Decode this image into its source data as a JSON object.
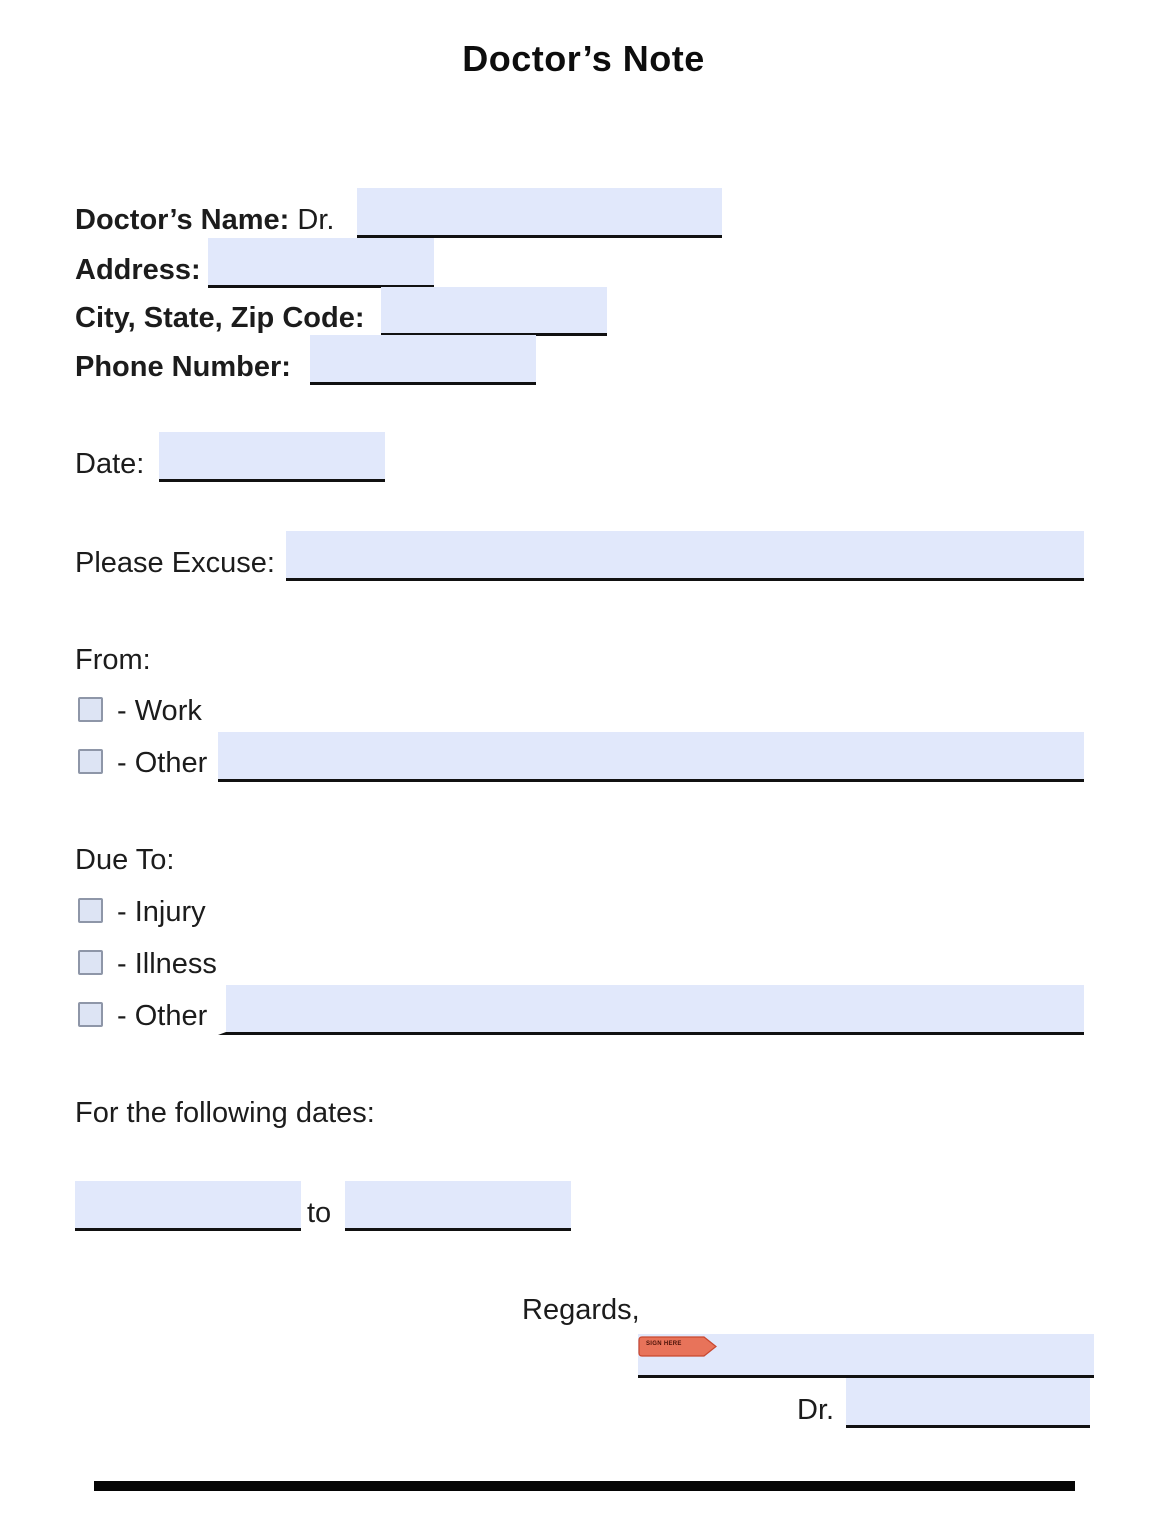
{
  "title": "Doctor’s Note",
  "doctor_info": {
    "name_label": "Doctor’s Name:",
    "name_prefix": "Dr.",
    "name_value": "",
    "address_label": "Address:",
    "address_value": "",
    "city_label": "City, State, Zip Code:",
    "city_value": "",
    "phone_label": "Phone Number:",
    "phone_value": ""
  },
  "date": {
    "label": "Date:",
    "value": ""
  },
  "excuse": {
    "label": "Please Excuse:",
    "value": ""
  },
  "from": {
    "heading": "From:",
    "options": [
      {
        "label": "- Work",
        "checked": false
      },
      {
        "label": "- Other",
        "checked": false,
        "other_value": ""
      }
    ]
  },
  "due_to": {
    "heading": "Due To:",
    "options": [
      {
        "label": "- Injury",
        "checked": false
      },
      {
        "label": "- Illness",
        "checked": false
      },
      {
        "label": "- Other",
        "checked": false,
        "other_value": ""
      }
    ]
  },
  "dates": {
    "heading": "For the following dates:",
    "from_value": "",
    "separator": "to",
    "to_value": ""
  },
  "closing": {
    "regards": "Regards,",
    "sign_here_tag": "SIGN HERE",
    "signature_value": "",
    "dr_prefix": "Dr.",
    "dr_name_value": ""
  },
  "colors": {
    "field_background": "#e1e8fb",
    "sign_tag": "#e8735a"
  }
}
